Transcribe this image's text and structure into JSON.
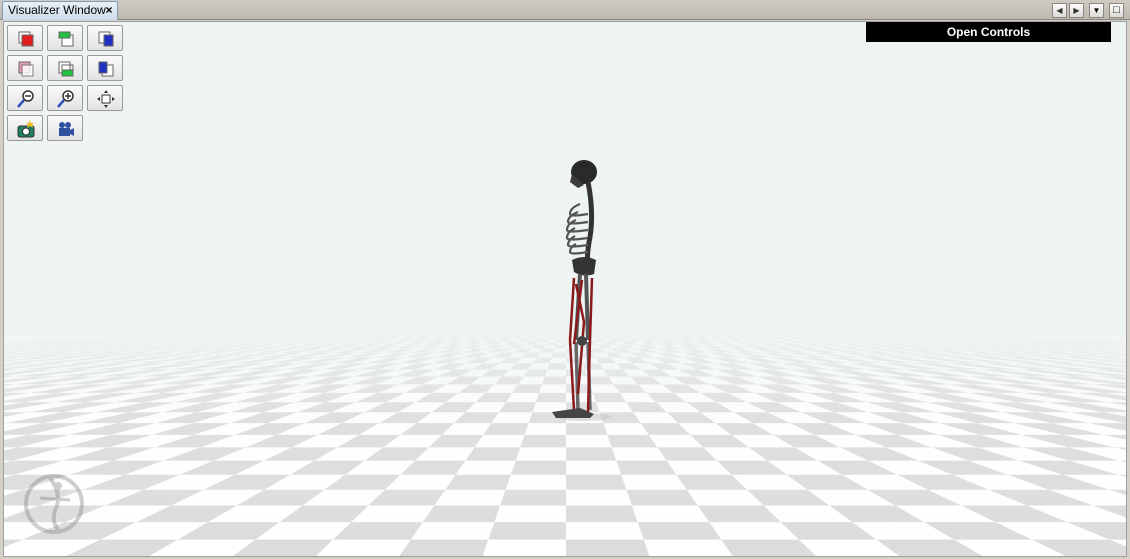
{
  "window": {
    "tab_title": "Visualizer Window",
    "tab_close": "×"
  },
  "window_controls": [
    {
      "name": "scroll-left",
      "glyph": "◀"
    },
    {
      "name": "scroll-right",
      "glyph": "▶"
    },
    {
      "name": "dropdown",
      "glyph": "▼"
    },
    {
      "name": "maximize",
      "glyph": "□"
    }
  ],
  "toolbar": {
    "buttons": [
      "view-front-icon",
      "view-top-icon",
      "view-right-icon",
      "view-back-icon",
      "view-bottom-icon",
      "view-left-icon",
      "zoom-out-icon",
      "zoom-in-icon",
      "fit-view-icon",
      "snapshot-icon",
      "record-movie-icon"
    ]
  },
  "controls_button": {
    "label": "Open Controls"
  },
  "colors": {
    "sky": "#eef3f3",
    "floor_light": "#ffffff",
    "floor_dark": "#dcdcdc",
    "muscle": "#8b1a1a"
  }
}
